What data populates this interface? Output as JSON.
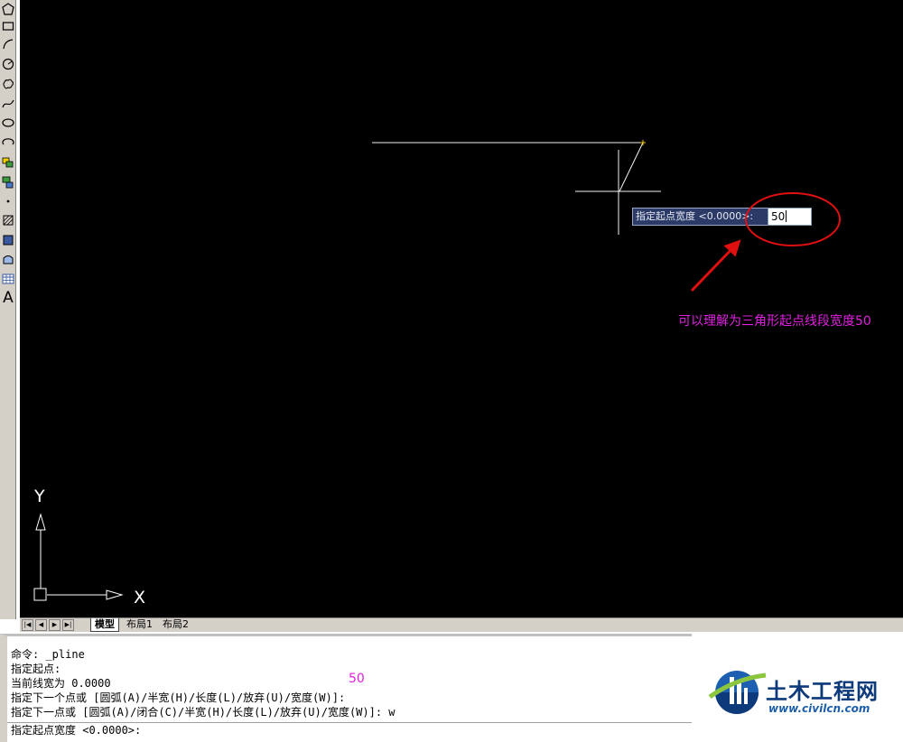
{
  "toolbar": {
    "text_tool_glyph": "A",
    "tools": [
      "polygon-icon",
      "rectangle-icon",
      "arc-icon",
      "circle-icon",
      "revision-cloud-icon",
      "spline-icon",
      "ellipse-icon",
      "ellipse-arc-icon",
      "insert-block-icon",
      "make-block-icon",
      "point-icon",
      "hatch-icon",
      "gradient-icon",
      "region-icon",
      "table-icon",
      "text-icon"
    ]
  },
  "canvas": {
    "background": "#000000",
    "ucs": {
      "x_label": "X",
      "y_label": "Y"
    }
  },
  "dynamic_input": {
    "prompt": "指定起点宽度 <0.0000>:",
    "value": "50"
  },
  "annotations": {
    "canvas_note": "可以理解为三角形起点线段宽度50",
    "command_note": "50",
    "color": "#e020e0"
  },
  "layout_tabs": {
    "nav": [
      "|◀",
      "◀",
      "▶",
      "▶|"
    ],
    "tabs": [
      "模型",
      "布局1",
      "布局2"
    ]
  },
  "command_window": {
    "history": [
      "命令:  _pline",
      "指定起点:",
      "当前线宽为 0.0000",
      "指定下一个点或 [圆弧(A)/半宽(H)/长度(L)/放弃(U)/宽度(W)]:",
      "指定下一点或 [圆弧(A)/闭合(C)/半宽(H)/长度(L)/放弃(U)/宽度(W)]: w"
    ],
    "prompt": "指定起点宽度 <0.0000>:"
  },
  "logo": {
    "title": "土木工程网",
    "url": "www.civilcn.com"
  }
}
